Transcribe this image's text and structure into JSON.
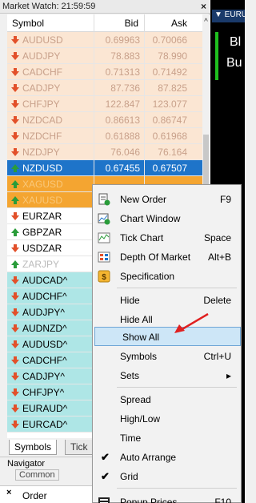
{
  "market_watch": {
    "title": "Market Watch: 21:59:59",
    "close": "×",
    "columns": {
      "symbol": "Symbol",
      "bid": "Bid",
      "ask": "Ask"
    },
    "rows": [
      {
        "symbol": "AUDUSD",
        "bid": "0.69963",
        "ask": "0.70066",
        "dir": "down",
        "style": "peach"
      },
      {
        "symbol": "AUDJPY",
        "bid": "78.883",
        "ask": "78.990",
        "dir": "down",
        "style": "peach"
      },
      {
        "symbol": "CADCHF",
        "bid": "0.71313",
        "ask": "0.71492",
        "dir": "down",
        "style": "peach"
      },
      {
        "symbol": "CADJPY",
        "bid": "87.736",
        "ask": "87.825",
        "dir": "down",
        "style": "peach"
      },
      {
        "symbol": "CHFJPY",
        "bid": "122.847",
        "ask": "123.077",
        "dir": "down",
        "style": "peach"
      },
      {
        "symbol": "NZDCAD",
        "bid": "0.86613",
        "ask": "0.86747",
        "dir": "down",
        "style": "peach"
      },
      {
        "symbol": "NZDCHF",
        "bid": "0.61888",
        "ask": "0.61968",
        "dir": "down",
        "style": "peach"
      },
      {
        "symbol": "NZDJPY",
        "bid": "76.046",
        "ask": "76.164",
        "dir": "down",
        "style": "peach"
      },
      {
        "symbol": "NZDUSD",
        "bid": "0.67455",
        "ask": "0.67507",
        "dir": "up",
        "style": "selected"
      },
      {
        "symbol": "XAGUSD",
        "bid": "",
        "ask": "",
        "dir": "up",
        "style": "orange"
      },
      {
        "symbol": "XAUUSD",
        "bid": "",
        "ask": "",
        "dir": "up",
        "style": "orange"
      },
      {
        "symbol": "EURZAR",
        "bid": "",
        "ask": "",
        "dir": "down",
        "style": "white"
      },
      {
        "symbol": "GBPZAR",
        "bid": "",
        "ask": "",
        "dir": "up",
        "style": "white"
      },
      {
        "symbol": "USDZAR",
        "bid": "",
        "ask": "",
        "dir": "down",
        "style": "white"
      },
      {
        "symbol": "ZARJPY",
        "bid": "",
        "ask": "",
        "dir": "up",
        "style": "white-faded"
      },
      {
        "symbol": "AUDCAD^",
        "bid": "",
        "ask": "",
        "dir": "down",
        "style": "cyan"
      },
      {
        "symbol": "AUDCHF^",
        "bid": "",
        "ask": "",
        "dir": "down",
        "style": "cyan"
      },
      {
        "symbol": "AUDJPY^",
        "bid": "",
        "ask": "",
        "dir": "down",
        "style": "cyan"
      },
      {
        "symbol": "AUDNZD^",
        "bid": "",
        "ask": "",
        "dir": "down",
        "style": "cyan"
      },
      {
        "symbol": "AUDUSD^",
        "bid": "",
        "ask": "",
        "dir": "down",
        "style": "cyan"
      },
      {
        "symbol": "CADCHF^",
        "bid": "",
        "ask": "",
        "dir": "down",
        "style": "cyan"
      },
      {
        "symbol": "CADJPY^",
        "bid": "",
        "ask": "",
        "dir": "down",
        "style": "cyan"
      },
      {
        "symbol": "CHFJPY^",
        "bid": "",
        "ask": "",
        "dir": "down",
        "style": "cyan"
      },
      {
        "symbol": "EURAUD^",
        "bid": "",
        "ask": "",
        "dir": "down",
        "style": "cyan"
      },
      {
        "symbol": "EURCAD^",
        "bid": "",
        "ask": "",
        "dir": "down",
        "style": "cyan"
      }
    ],
    "tabs": {
      "symbols": "Symbols",
      "tick": "Tick"
    }
  },
  "navigator": {
    "title": "Navigator",
    "common": "Common"
  },
  "order_bar": {
    "close": "×",
    "label": "Order"
  },
  "chart": {
    "title": "▼ EURU",
    "text1": "Bl",
    "text2": "Bu"
  },
  "context_menu": {
    "items": [
      {
        "label": "New Order",
        "shortcut": "F9",
        "icon": "new-order-icon"
      },
      {
        "label": "Chart Window",
        "shortcut": "",
        "icon": "chart-window-icon"
      },
      {
        "label": "Tick Chart",
        "shortcut": "Space",
        "icon": "tick-chart-icon"
      },
      {
        "label": "Depth Of Market",
        "shortcut": "Alt+B",
        "icon": "depth-of-market-icon"
      },
      {
        "label": "Specification",
        "shortcut": "",
        "icon": "specification-icon"
      },
      {
        "label": "Hide",
        "shortcut": "Delete",
        "icon": ""
      },
      {
        "label": "Hide All",
        "shortcut": "",
        "icon": ""
      },
      {
        "label": "Show All",
        "shortcut": "",
        "icon": "",
        "highlighted": true
      },
      {
        "label": "Symbols",
        "shortcut": "Ctrl+U",
        "icon": ""
      },
      {
        "label": "Sets",
        "shortcut": "▸",
        "icon": ""
      },
      {
        "label": "Spread",
        "shortcut": "",
        "icon": ""
      },
      {
        "label": "High/Low",
        "shortcut": "",
        "icon": ""
      },
      {
        "label": "Time",
        "shortcut": "",
        "icon": ""
      },
      {
        "label": "Auto Arrange",
        "shortcut": "",
        "icon": "check-icon"
      },
      {
        "label": "Grid",
        "shortcut": "",
        "icon": "check-icon"
      },
      {
        "label": "Popup Prices",
        "shortcut": "F10",
        "icon": "popup-prices-icon"
      }
    ]
  },
  "colors": {
    "down_arrow": "#e2502a",
    "up_arrow": "#2a9c3a",
    "selected": "#1e74c9",
    "highlight": "#cde6f7",
    "annotation_arrow": "#e02020"
  }
}
